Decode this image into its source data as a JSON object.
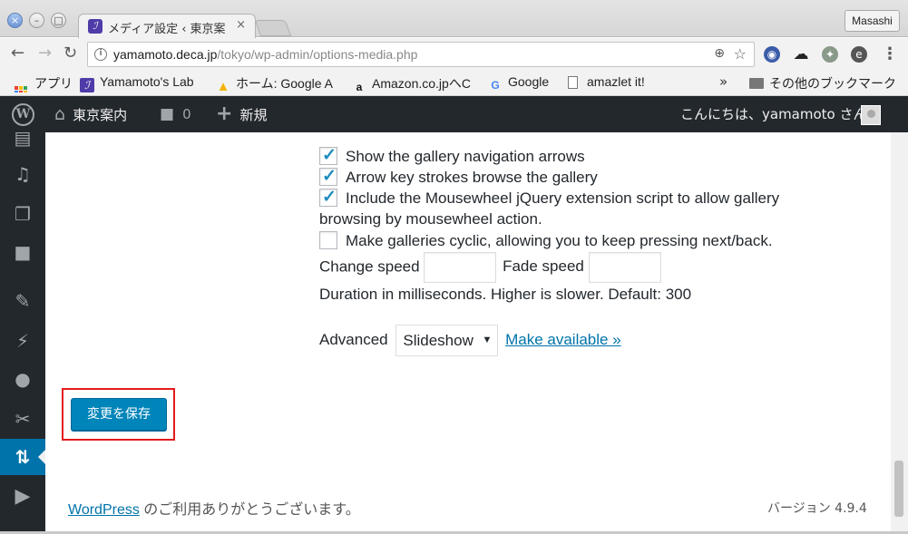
{
  "browser": {
    "tab_title": "メディア設定 ‹ 東京案",
    "tab_close": "×",
    "profile_name": "Masashi",
    "url_host": "yamamoto.deca.jp",
    "url_path": "/tokyo/wp-admin/options-media.php",
    "bookmarks": [
      {
        "label": "アプリ",
        "icon": "apps-grid-icon"
      },
      {
        "label": "Yamamoto's Lab",
        "icon": "lab-favicon-icon"
      },
      {
        "label": "ホーム: Google A",
        "icon": "google-drive-icon"
      },
      {
        "label": "Amazon.co.jpへC",
        "icon": "amazon-icon"
      },
      {
        "label": "Google",
        "icon": "google-icon"
      },
      {
        "label": "amazlet it!",
        "icon": "page-icon"
      }
    ],
    "bookmarks_more": "»",
    "other_bookmarks": "その他のブックマーク"
  },
  "adminbar": {
    "site_name": "東京案内",
    "comments_count": "0",
    "new_label": "新規",
    "greeting": "こんにちは、yamamoto さん"
  },
  "settings": {
    "option_nav_arrows": {
      "label": "Show the gallery navigation arrows",
      "checked": true
    },
    "option_arrow_keys": {
      "label": "Arrow key strokes browse the gallery",
      "checked": true
    },
    "option_mousewheel": {
      "label": "Include the Mousewheel jQuery extension script to allow gallery",
      "label_cont": "browsing by mousewheel action.",
      "checked": true
    },
    "option_cyclic": {
      "label": "Make galleries cyclic, allowing you to keep pressing next/back.",
      "checked": false
    },
    "change_speed_label": "Change speed",
    "change_speed_value": "",
    "fade_speed_label": "Fade speed",
    "fade_speed_value": "",
    "duration_hint": "Duration in milliseconds. Higher is slower. Default: 300",
    "advanced_label": "Advanced",
    "advanced_value": "Slideshow",
    "make_available": "Make available »",
    "save_button": "変更を保存"
  },
  "footer": {
    "wp_link": "WordPress",
    "thanks_text": " のご利用ありがとうございます。",
    "version": "バージョン 4.9.4"
  },
  "colors": {
    "admin_dark": "#23282d",
    "wp_blue": "#0073aa",
    "button_blue": "#0085ba",
    "highlight_red": "#e31b1b"
  }
}
